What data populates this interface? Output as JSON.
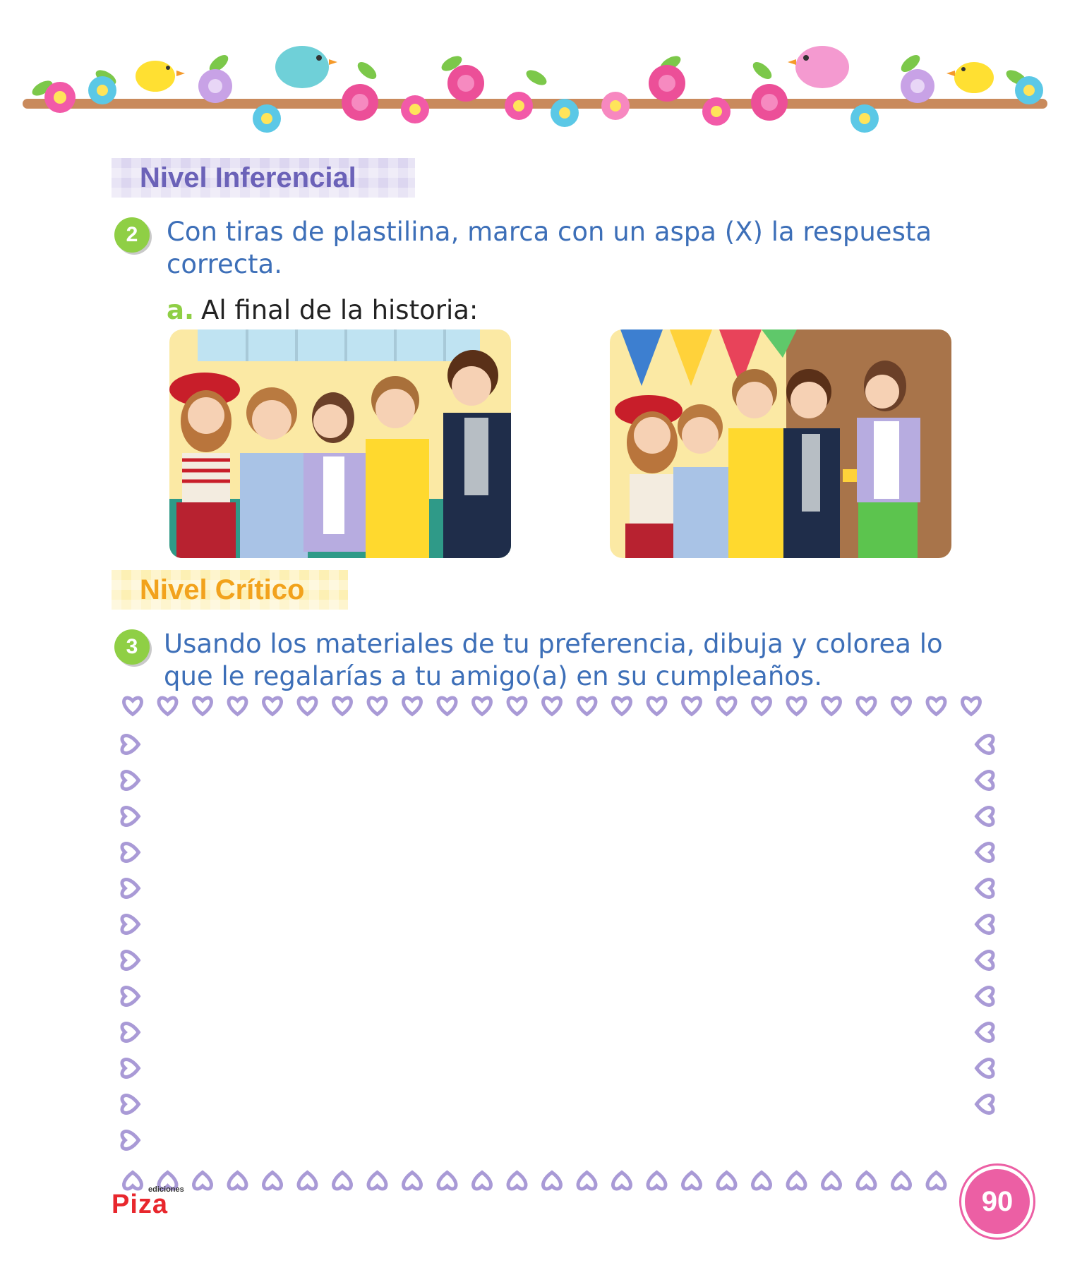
{
  "sections": {
    "inferencial": "Nivel Inferencial",
    "critico": "Nivel Crítico"
  },
  "question2": {
    "number": "2",
    "text": "Con tiras de plastilina, marca con un aspa (X) la respuesta correcta.",
    "item_letter": "a.",
    "item_text": "Al final de la historia:"
  },
  "question3": {
    "number": "3",
    "text": "Usando los materiales de tu preferencia, dibuja y colorea lo que le regalarías a tu amigo(a) en su cumpleaños."
  },
  "footer": {
    "logo_small": "ediciones",
    "logo_main": "Piza",
    "page_number": "90"
  },
  "colors": {
    "inferencial_text": "#6b62b8",
    "critico_text": "#f2a21c",
    "question_text": "#3d6fb8",
    "badge": "#8fcf45",
    "hearts": "#a99ad6",
    "page_badge": "#ec5fa4"
  }
}
